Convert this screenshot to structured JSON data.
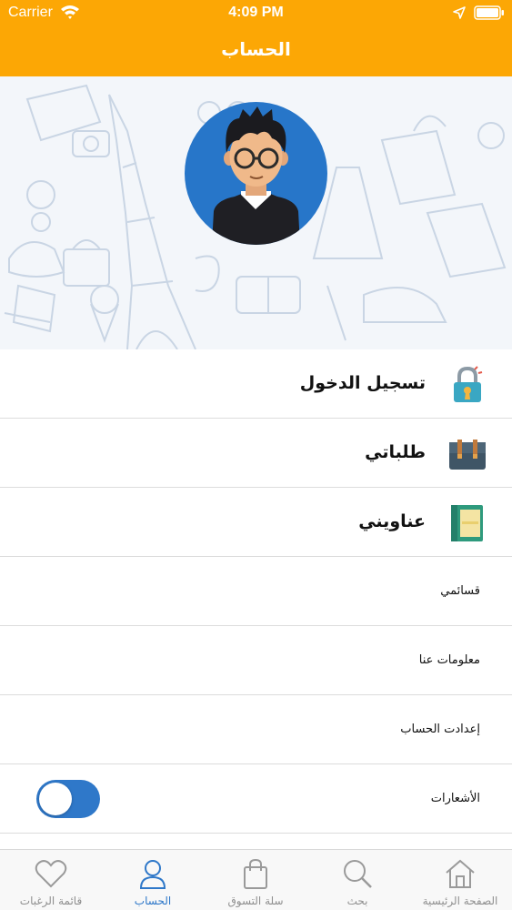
{
  "status_bar": {
    "carrier": "Carrier",
    "time": "4:09 PM"
  },
  "nav": {
    "title": "الحساب"
  },
  "profile": {
    "avatar": "user-avatar-illustration"
  },
  "menu": {
    "login": {
      "label": "تسجيل الدخول",
      "icon": "padlock-icon"
    },
    "orders": {
      "label": "طلباتي",
      "icon": "briefcase-icon"
    },
    "addresses": {
      "label": "عناويني",
      "icon": "address-book-icon"
    },
    "lists": {
      "label": "قسائمي"
    },
    "about": {
      "label": "معلومات عنا"
    },
    "settings": {
      "label": "إعدادت الحساب"
    },
    "notifications": {
      "label": "الأشعارات",
      "enabled": true
    }
  },
  "tabs": [
    {
      "label": "قائمة الرغبات",
      "icon": "heart-icon"
    },
    {
      "label": "الحساب",
      "icon": "person-icon",
      "active": true
    },
    {
      "label": "سلة التسوق",
      "icon": "shopping-bag-icon"
    },
    {
      "label": "بحث",
      "icon": "search-icon"
    },
    {
      "label": "الصفحة الرئيسية",
      "icon": "home-icon"
    }
  ],
  "colors": {
    "accent": "#fca705",
    "brand_blue": "#2f78c9",
    "avatar_bg": "#2776c9"
  }
}
